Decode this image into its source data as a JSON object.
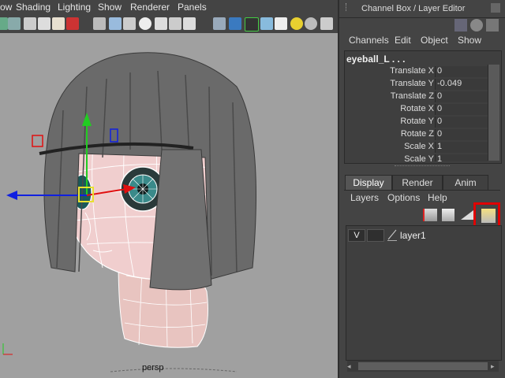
{
  "viewport": {
    "menus": [
      {
        "label": "View",
        "visible": "ow"
      },
      {
        "label": "Shading"
      },
      {
        "label": "Lighting"
      },
      {
        "label": "Show"
      },
      {
        "label": "Renderer"
      },
      {
        "label": "Panels"
      }
    ],
    "camera_label": "persp"
  },
  "panel": {
    "title": "Channel Box / Layer Editor",
    "channel_menu": [
      "Channels",
      "Edit",
      "Object",
      "Show"
    ],
    "node_name": "eyeball_L . . .",
    "attributes": [
      {
        "label": "Translate X",
        "value": "0"
      },
      {
        "label": "Translate Y",
        "value": "-0.049"
      },
      {
        "label": "Translate Z",
        "value": "0"
      },
      {
        "label": "Rotate X",
        "value": "0"
      },
      {
        "label": "Rotate Y",
        "value": "0"
      },
      {
        "label": "Rotate Z",
        "value": "0"
      },
      {
        "label": "Scale X",
        "value": "1"
      },
      {
        "label": "Scale Y",
        "value": "1"
      }
    ],
    "tabs": [
      "Display",
      "Render",
      "Anim"
    ],
    "active_tab": "Display",
    "layer_menu": [
      "Layers",
      "Options",
      "Help"
    ],
    "layers": [
      {
        "visibility": "V",
        "name": "layer1"
      }
    ]
  },
  "colors": {
    "highlight": "#e00000",
    "manip_y": "#22cc22",
    "manip_x": "#e01010",
    "manip_z": "#1020e0"
  }
}
